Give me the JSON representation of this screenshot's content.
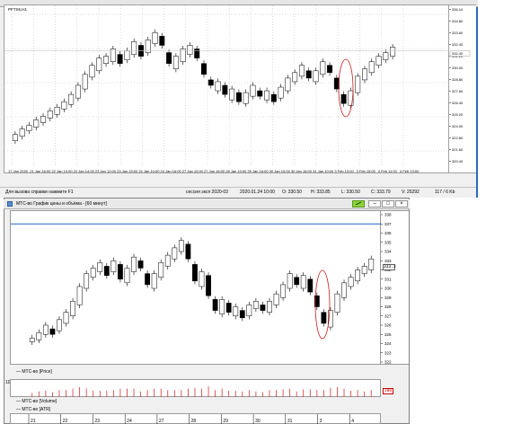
{
  "top_window": {
    "symbol_label": "PFTS6,H1",
    "x_ticks": [
      "17 Jan 2020",
      "21 Jan 16:00",
      "22 Jan 10:00",
      "22 Jan 14:00",
      "23 Jan 12:00",
      "23 Jan 15:00",
      "24 Jan 10:00",
      "24 Jan 16:00",
      "27 Jan 10:00",
      "27 Jan 16:00",
      "28 Jan 10:00",
      "29 Jan 16:00",
      "30 Jan 10:00",
      "30 Jan 16:00",
      "31 Jan 10:00",
      "3 Feb 13:00",
      "3 Feb 15:00",
      "4 Feb 11:00",
      "4 Feb 13:00"
    ],
    "y_ticks": [
      "336.10",
      "334.80",
      "333.60",
      "332.40",
      "331.20",
      "330.00",
      "328.80",
      "327.60",
      "326.40",
      "325.20",
      "324.00",
      "322.80",
      "321.60",
      "320.40"
    ],
    "current_price": "332.40",
    "status": {
      "help": "Для вызова справки нажмите F1",
      "session": "сессия эксп 2020-03",
      "datetime": "2020.01.24 10:00",
      "open": "O: 330.50",
      "high": "H: 333.85",
      "low": "L: 330.50",
      "close": "C: 333.79",
      "volume": "V: 25292",
      "traffic": "117 / 6 Kb"
    }
  },
  "bottom_window": {
    "title": "МТС-во График цены и объёма - [60 минут]",
    "buttons": [
      "minimize",
      "maximize",
      "close"
    ],
    "y_ticks": [
      "338",
      "337",
      "336",
      "335",
      "334",
      "333",
      "332",
      "331",
      "330",
      "329",
      "328",
      "327",
      "326",
      "325",
      "324",
      "323",
      "322"
    ],
    "price_box": "333.3",
    "price_legend": "МТС-во [Price]",
    "volume_legend": "МТС-во [Volume]",
    "volume_scale_top": "100 000",
    "volume_scale_bottom": "0",
    "volume_box": "300",
    "atr_legend": "МТС-во [ATR]",
    "day_labels": [
      "21",
      "22",
      "23",
      "24",
      "27",
      "28",
      "29",
      "30",
      "31",
      "3",
      "4"
    ]
  },
  "chart_data": [
    {
      "type": "candlestick",
      "name": "top",
      "ylim": [
        320.0,
        337.0
      ],
      "grid": true,
      "bars": [
        322.5,
        323.2,
        323.0,
        323.8,
        323.6,
        324.2,
        324.0,
        324.8,
        324.5,
        325.2,
        325.0,
        325.8,
        325.4,
        326.2,
        326.0,
        326.8,
        326.5,
        327.6,
        327.2,
        328.6,
        328.2,
        329.8,
        329.5,
        330.8,
        330.2,
        331.6,
        331.0,
        331.8,
        331.2,
        332.6,
        332.0,
        331.0,
        331.4,
        332.4,
        332.0,
        333.4,
        333.0,
        331.8,
        332.2,
        333.6,
        333.2,
        334.4,
        334.0,
        333.0,
        332.2,
        331.0,
        330.4,
        331.8,
        331.2,
        332.6,
        332.0,
        333.0,
        332.6,
        331.6,
        331.0,
        329.8,
        329.2,
        328.6,
        328.0,
        329.0,
        328.6,
        327.6,
        327.0,
        328.2,
        327.8,
        326.8,
        326.6,
        327.8,
        327.4,
        328.6,
        328.0,
        327.4,
        327.0,
        328.0,
        327.6,
        326.8,
        327.2,
        328.4,
        328.0,
        329.4,
        329.0,
        330.0,
        329.6,
        330.8,
        330.2,
        329.4,
        329.0,
        330.2,
        329.8,
        331.2,
        330.8,
        330.0,
        329.4,
        328.2,
        327.6,
        326.6,
        326.4,
        328.0,
        327.8,
        329.6,
        329.2,
        330.4,
        330.0,
        331.2,
        330.8,
        331.8,
        331.4,
        332.2,
        331.8,
        332.8
      ]
    },
    {
      "type": "candlestick",
      "name": "bottom",
      "ylim": [
        322.0,
        338.0
      ],
      "grid": false,
      "bars": [
        324.2,
        324.6,
        324.4,
        325.2,
        325.0,
        326.0,
        325.6,
        325.0,
        325.4,
        326.6,
        326.2,
        327.4,
        327.0,
        328.6,
        328.2,
        330.2,
        330.0,
        331.6,
        331.2,
        332.2,
        331.8,
        332.8,
        332.4,
        331.4,
        331.8,
        333.0,
        332.6,
        331.0,
        330.6,
        332.2,
        331.8,
        333.4,
        333.0,
        332.2,
        331.6,
        330.4,
        330.0,
        331.6,
        331.2,
        332.8,
        332.4,
        333.6,
        333.2,
        334.4,
        334.0,
        335.2,
        334.8,
        333.2,
        332.6,
        330.8,
        330.2,
        331.8,
        331.4,
        329.2,
        328.8,
        327.6,
        327.2,
        328.8,
        328.4,
        327.4,
        327.0,
        328.0,
        327.6,
        326.8,
        327.0,
        328.2,
        327.8,
        328.6,
        328.2,
        327.6,
        327.4,
        328.6,
        328.2,
        329.4,
        329.0,
        330.4,
        330.0,
        331.6,
        331.2,
        330.4,
        330.0,
        331.4,
        331.0,
        329.6,
        329.2,
        328.0,
        327.4,
        326.2,
        325.8,
        327.6,
        327.4,
        329.4,
        329.0,
        330.6,
        330.2,
        331.2,
        330.8,
        332.0,
        331.6,
        332.4,
        332.0,
        333.2
      ]
    }
  ]
}
